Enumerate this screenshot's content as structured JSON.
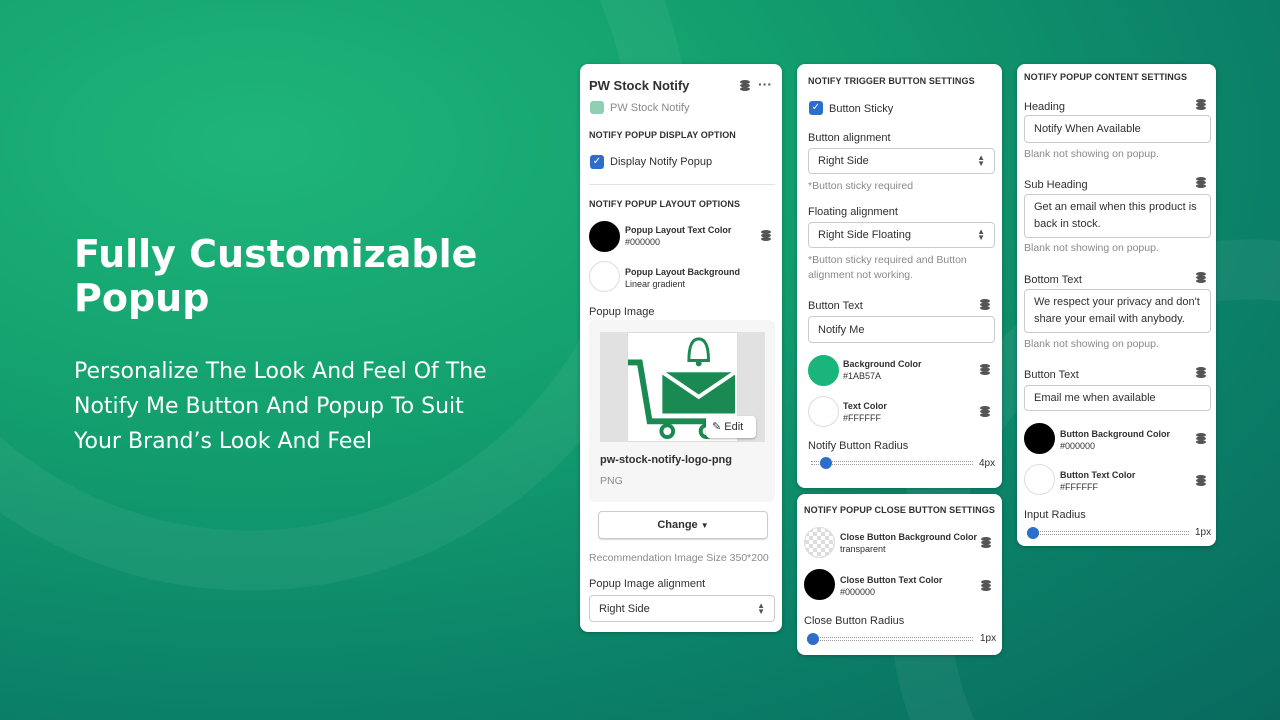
{
  "hero": {
    "title": "Fully Customizable Popup",
    "subtitle": "Personalize The Look And Feel Of The Notify Me Button And Popup To Suit Your Brand’s Look And Feel"
  },
  "colors": {
    "accent": "#1AB57A",
    "checkbox": "#2c6ecb"
  },
  "panel1": {
    "title": "PW Stock Notify",
    "app_name": "PW Stock Notify",
    "display_section": "NOTIFY POPUP DISPLAY OPTION",
    "display_checkbox": "Display Notify Popup",
    "layout_section": "NOTIFY POPUP LAYOUT OPTIONS",
    "text_color_label": "Popup Layout Text Color",
    "text_color_value": "#000000",
    "bg_label": "Popup Layout Background",
    "bg_value": "Linear gradient",
    "image_label": "Popup Image",
    "edit_label": "Edit",
    "file_name": "pw-stock-notify-logo-png",
    "file_type": "PNG",
    "change_label": "Change",
    "recommendation": "Recommendation Image Size 350*200",
    "align_label": "Popup Image alignment",
    "align_value": "Right Side"
  },
  "panel2": {
    "section": "NOTIFY TRIGGER BUTTON SETTINGS",
    "sticky_label": "Button Sticky",
    "alignment_label": "Button alignment",
    "alignment_value": "Right Side",
    "alignment_help": "*Button sticky required",
    "floating_label": "Floating alignment",
    "floating_value": "Right Side Floating",
    "floating_help": "*Button sticky required and Button alignment not working.",
    "text_label": "Button Text",
    "text_value": "Notify Me",
    "bg_label": "Background Color",
    "bg_value": "#1AB57A",
    "tc_label": "Text Color",
    "tc_value": "#FFFFFF",
    "radius_label": "Notify Button Radius",
    "radius_value": "4px"
  },
  "panel3": {
    "section": "NOTIFY POPUP CLOSE BUTTON SETTINGS",
    "bg_label": "Close Button Background Color",
    "bg_value": "transparent",
    "tc_label": "Close Button Text Color",
    "tc_value": "#000000",
    "radius_label": "Close Button Radius",
    "radius_value": "1px"
  },
  "panel4": {
    "section": "NOTIFY POPUP CONTENT SETTINGS",
    "heading_label": "Heading",
    "heading_value": "Notify When Available",
    "heading_help": "Blank not showing on popup.",
    "sub_label": "Sub Heading",
    "sub_value": "Get an email when this product is back in stock.",
    "sub_help": "Blank not showing on popup.",
    "bottom_label": "Bottom Text",
    "bottom_value": "We respect your privacy and don't share your email with anybody.",
    "bottom_help": "Blank not showing on popup.",
    "btn_label": "Button Text",
    "btn_value": "Email me when available",
    "btnbg_label": "Button Background Color",
    "btnbg_value": "#000000",
    "btntc_label": "Button Text Color",
    "btntc_value": "#FFFFFF",
    "radius_label": "Input Radius",
    "radius_value": "1px"
  }
}
